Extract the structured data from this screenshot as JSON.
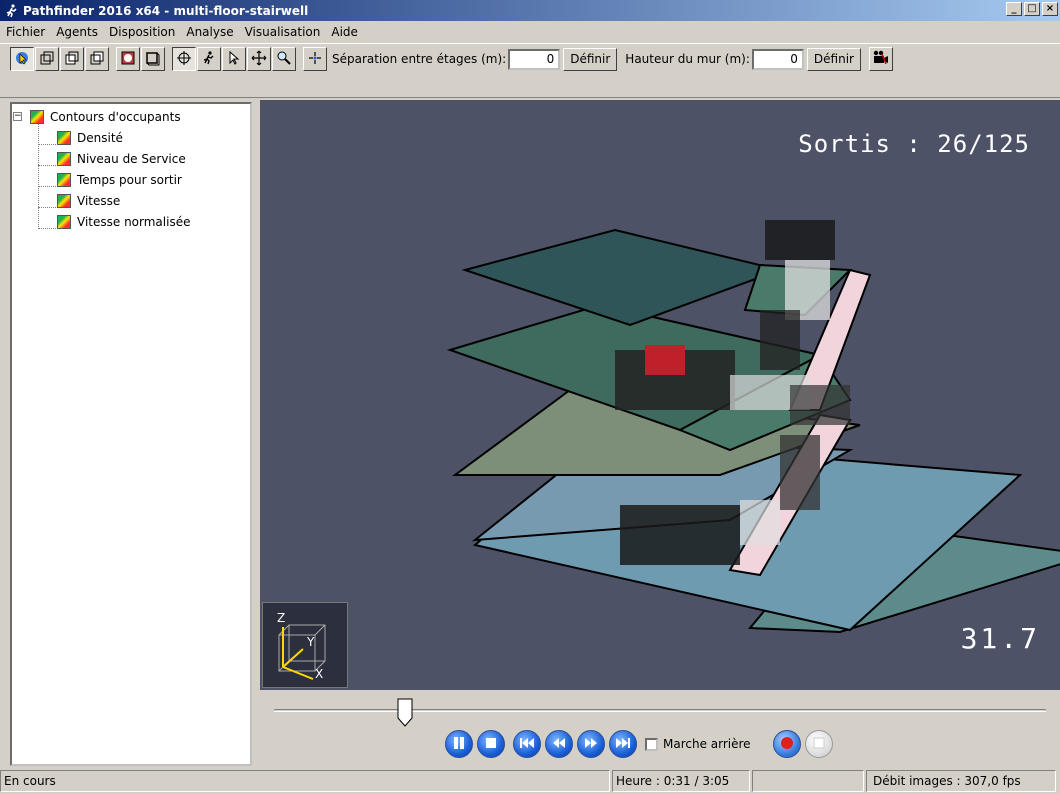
{
  "window": {
    "title": "Pathfinder 2016 x64 - multi-floor-stairwell"
  },
  "menu": [
    "Fichier",
    "Agents",
    "Disposition",
    "Analyse",
    "Visualisation",
    "Aide"
  ],
  "toolbar": {
    "floor_sep_label": "Séparation entre étages (m):",
    "floor_sep_value": "0",
    "define1": "Définir",
    "wall_height_label": "Hauteur du mur (m):",
    "wall_height_value": "0",
    "define2": "Définir"
  },
  "tree": {
    "root": "Contours d'occupants",
    "children": [
      "Densité",
      "Niveau de Service",
      "Temps pour sortir",
      "Vitesse",
      "Vitesse normalisée"
    ]
  },
  "viewport": {
    "exited": "Sortis : 26/125",
    "frame_value": "31.7",
    "axis_labels": {
      "z": "Z",
      "y": "Y",
      "x": "X"
    }
  },
  "playback": {
    "progress": 0.17,
    "reverse_label": "Marche arrière",
    "reverse_checked": false
  },
  "status": {
    "state": "En cours",
    "time": "Heure : 0:31 / 3:05",
    "fps": "Débit images : 307,0 fps"
  }
}
